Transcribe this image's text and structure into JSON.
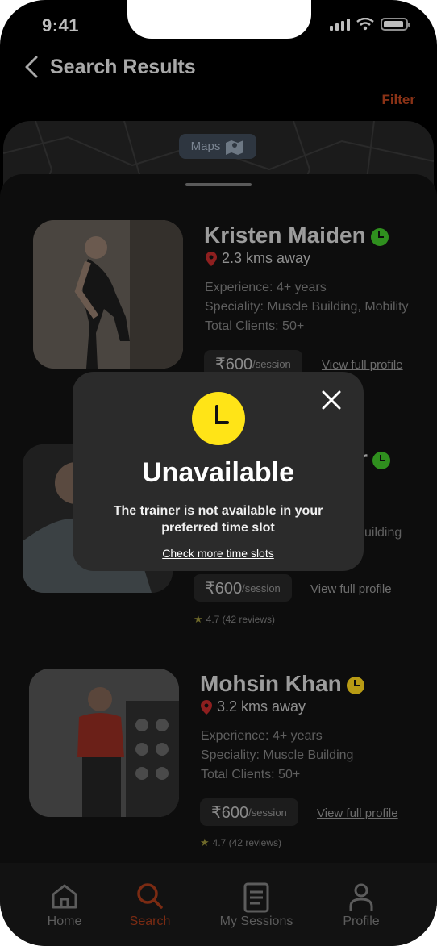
{
  "status": {
    "time": "9:41"
  },
  "header": {
    "title": "Search Results",
    "filter_label": "Filter"
  },
  "map": {
    "pill_label": "Maps"
  },
  "trainers": [
    {
      "name": "Kristen Maiden",
      "availability_color": "#2f8f1e",
      "distance": "2.3 kms away",
      "experience": "Experience: 4+ years",
      "speciality": "Speciality: Muscle Building, Mobility",
      "clients": "Total Clients: 50+",
      "price": "₹600",
      "price_unit": "/session",
      "view_label": "View full profile"
    },
    {
      "name_visible_fragment": "r",
      "availability_color": "#2f8f1e",
      "speciality_fragment": "uilding",
      "price": "₹600",
      "price_unit": "/session",
      "view_label": "View full profile",
      "rating": "4.7 (42 reviews)"
    },
    {
      "name": "Mohsin Khan",
      "availability_color": "#b89b14",
      "distance": "3.2 kms away",
      "experience": "Experience: 4+ years",
      "speciality": "Speciality: Muscle Building",
      "clients": "Total Clients: 50+",
      "price": "₹600",
      "price_unit": "/session",
      "view_label": "View full profile",
      "rating": "4.7 (42 reviews)"
    }
  ],
  "nav": {
    "items": [
      {
        "label": "Home",
        "icon": "home-icon"
      },
      {
        "label": "Search",
        "icon": "search-icon",
        "active": true
      },
      {
        "label": "My Sessions",
        "icon": "sessions-icon"
      },
      {
        "label": "Profile",
        "icon": "profile-icon"
      }
    ]
  },
  "modal": {
    "title": "Unavailable",
    "message": "The trainer is not available in your preferred time slot",
    "link_label": "Check more time slots",
    "icon": "clock-icon",
    "accent_color": "#ffe417"
  },
  "colors": {
    "accent": "#e0582a",
    "background": "#000000"
  }
}
